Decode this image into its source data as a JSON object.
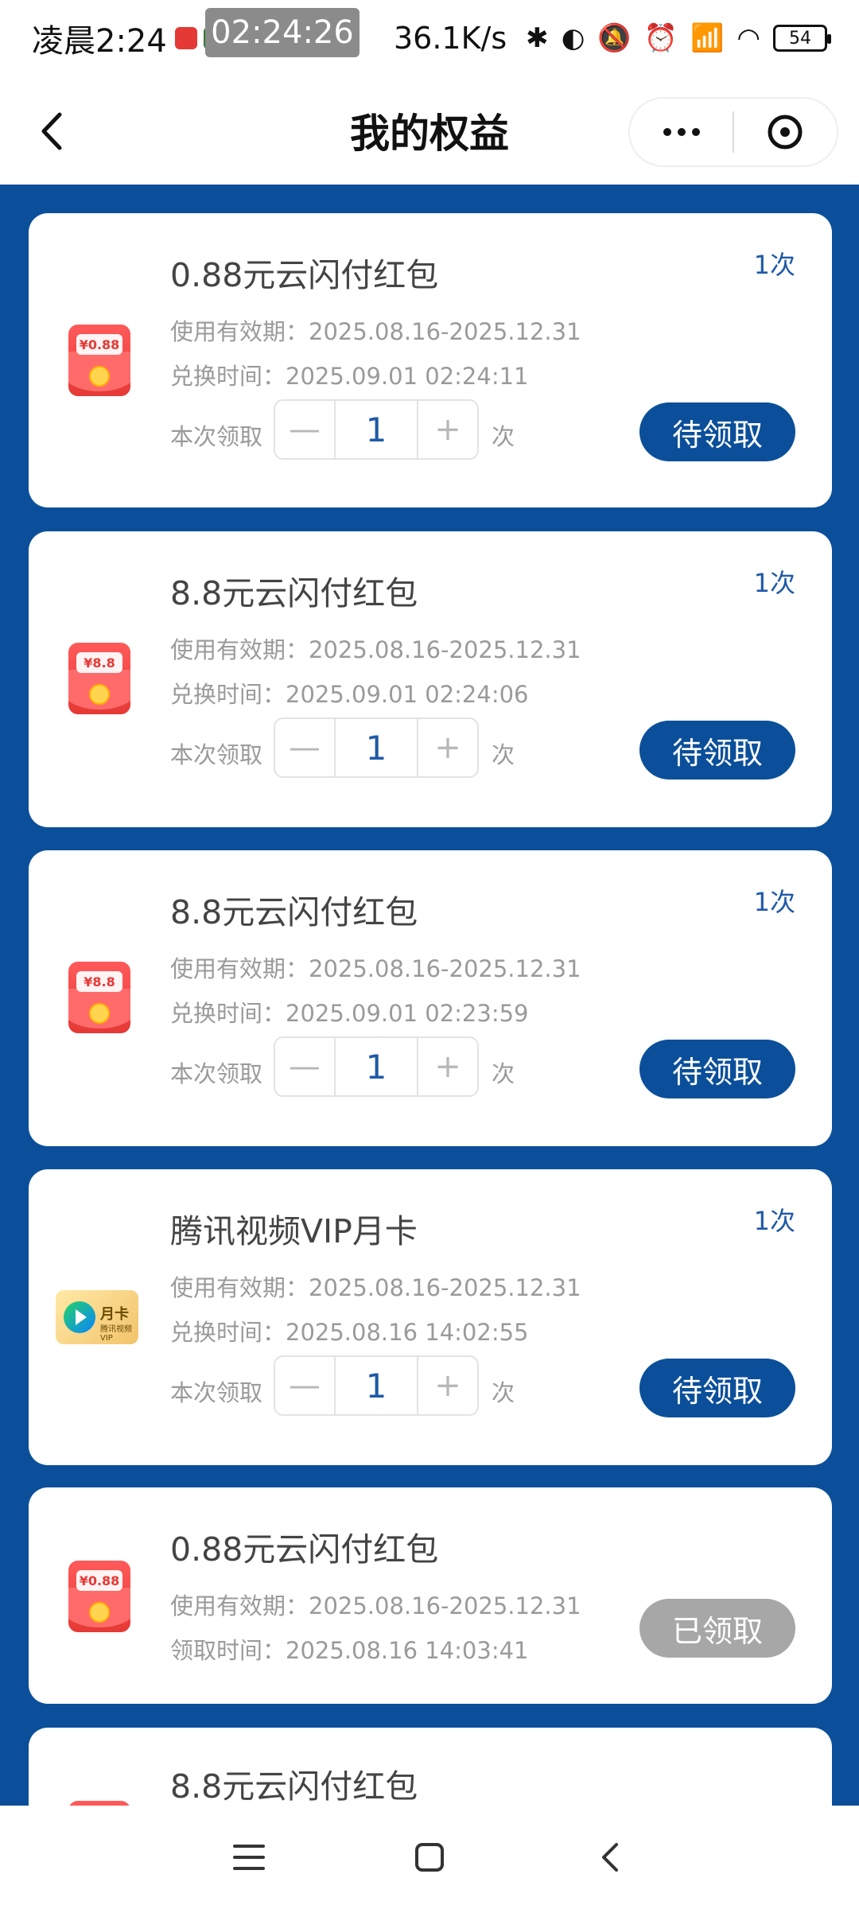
{
  "status_bar": {
    "time": "凌晨2:24",
    "timer": "02:24:26",
    "speed": "36.1K/s",
    "battery": "54",
    "icons": [
      "bluetooth-icon",
      "toggle-icon",
      "mute-icon",
      "alarm-icon",
      "signal-icon",
      "wifi-icon"
    ]
  },
  "nav": {
    "title": "我的权益",
    "back_icon": "chevron-left-icon",
    "more_icon": "more-dots-icon",
    "close_icon": "close-circle-icon"
  },
  "cards": [
    {
      "title": "0.88元云闪付红包",
      "count": "1次",
      "validity": "使用有效期：2025.08.16-2025.12.31",
      "time": "兑换时间：2025.09.01 02:24:11",
      "qty_label": "本次领取",
      "qty": "1",
      "qty_unit": "次",
      "button": "待领取",
      "icon_label": "¥0.88"
    },
    {
      "title": "8.8元云闪付红包",
      "count": "1次",
      "validity": "使用有效期：2025.08.16-2025.12.31",
      "time": "兑换时间：2025.09.01 02:24:06",
      "qty_label": "本次领取",
      "qty": "1",
      "qty_unit": "次",
      "button": "待领取",
      "icon_label": "¥8.8"
    },
    {
      "title": "8.8元云闪付红包",
      "count": "1次",
      "validity": "使用有效期：2025.08.16-2025.12.31",
      "time": "兑换时间：2025.09.01 02:23:59",
      "qty_label": "本次领取",
      "qty": "1",
      "qty_unit": "次",
      "button": "待领取",
      "icon_label": "¥8.8"
    },
    {
      "title": "腾讯视频VIP月卡",
      "count": "1次",
      "validity": "使用有效期：2025.08.16-2025.12.31",
      "time": "兑换时间：2025.08.16 14:02:55",
      "qty_label": "本次领取",
      "qty": "1",
      "qty_unit": "次",
      "button": "待领取",
      "icon_label": "月卡",
      "icon_sub": "腾讯视频VIP"
    },
    {
      "title": "0.88元云闪付红包",
      "validity": "使用有效期：2025.08.16-2025.12.31",
      "time": "领取时间：2025.08.16 14:03:41",
      "button": "已领取",
      "icon_label": "¥0.88"
    },
    {
      "title": "8.8元云闪付红包"
    }
  ],
  "bottom_nav": {
    "icons": [
      "menu-icon",
      "home-square-icon",
      "back-triangle-icon"
    ]
  }
}
